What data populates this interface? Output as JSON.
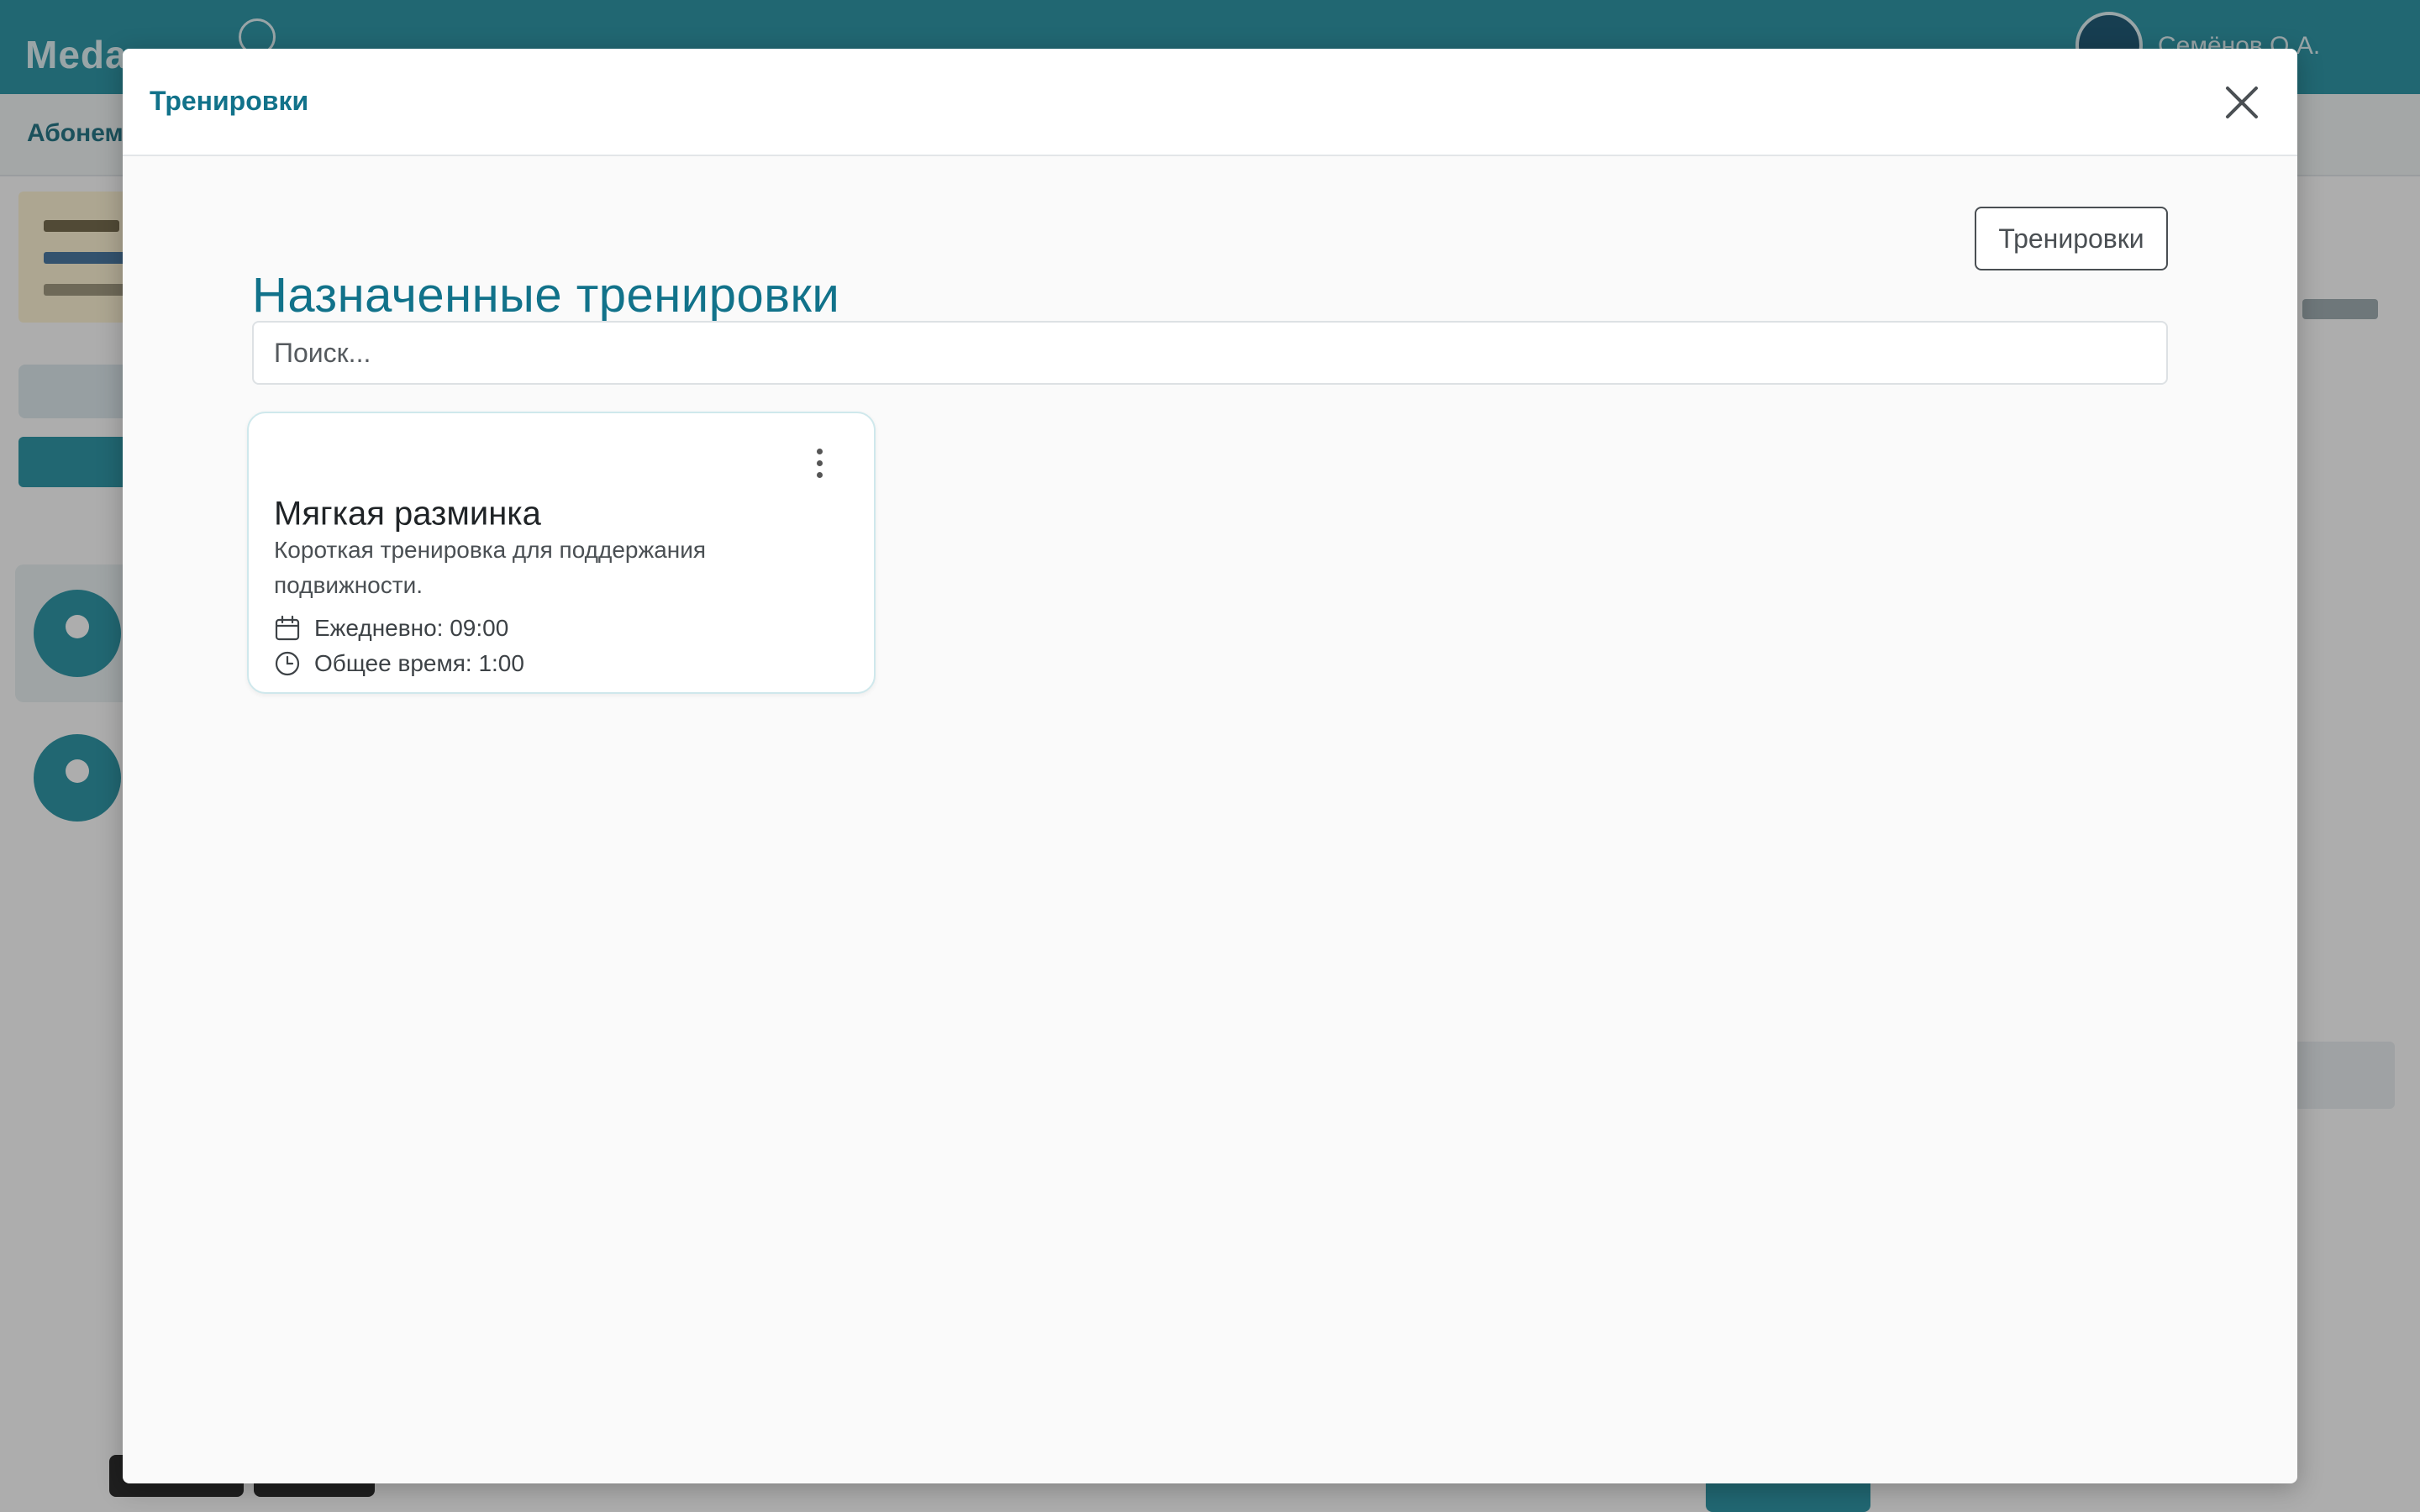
{
  "background": {
    "logo_text": "Meda",
    "user_name": "Семёнов О.А.",
    "subnav_label": "Абонем"
  },
  "modal": {
    "title": "Тренировки",
    "close_icon": "close-icon"
  },
  "page": {
    "heading": "Назначенные тренировки",
    "trainings_button": "Тренировки",
    "search_placeholder": "Поиск..."
  },
  "cards": [
    {
      "title": "Мягкая разминка",
      "description": "Короткая тренировка для поддержания подвижности.",
      "schedule": "Ежедневно: 09:00",
      "schedule_icon": "calendar-icon",
      "total_time": "Общее время: 1:00",
      "total_time_icon": "clock-icon",
      "menu_icon": "more-vertical-icon"
    }
  ],
  "colors": {
    "brand": "#1e8fa1",
    "heading": "#11728a",
    "card_border": "#cfe8ec"
  }
}
